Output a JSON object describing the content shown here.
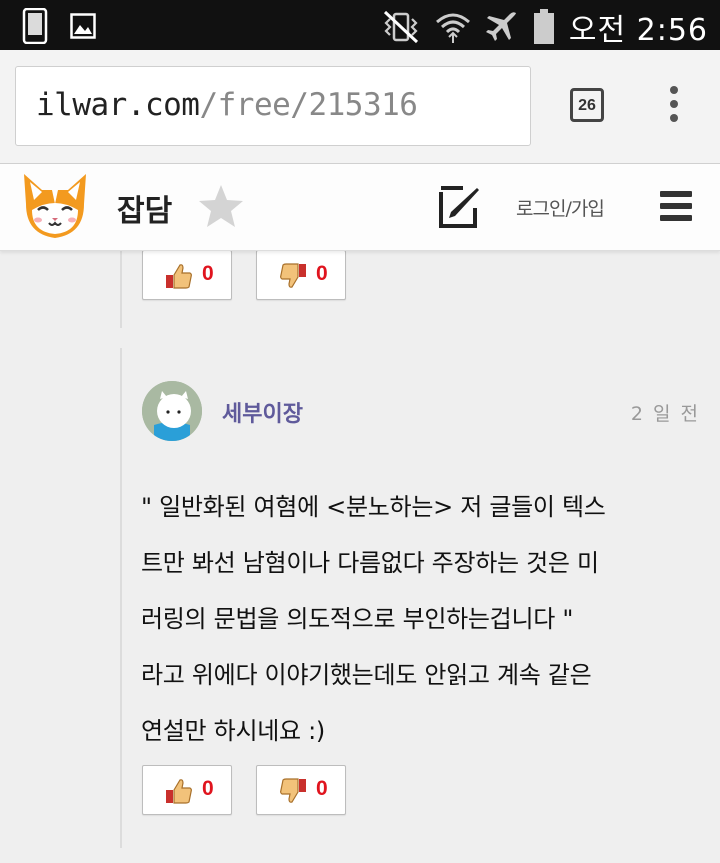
{
  "status_bar": {
    "time": "오전 2:56",
    "icons": [
      "phone-icon",
      "image-icon",
      "vibrate-icon",
      "wifi-icon",
      "airplane-icon",
      "battery-icon"
    ]
  },
  "browser": {
    "url_host": "ilwar.com",
    "url_path": "/free/215316",
    "tab_count": "26"
  },
  "site_header": {
    "title": "잡담",
    "login_label": "로그인/가입"
  },
  "colors": {
    "vote_count": "#e0141e",
    "author": "#5f5a9b",
    "background": "#efefef"
  },
  "prev_comment": {
    "likes": "0",
    "dislikes": "0"
  },
  "comment": {
    "author": "세부이장",
    "time_ago": "2 일 전",
    "lines": [
      "\" 일반화된 여혐에 <분노하는> 저 글들이 텍스",
      "트만 봐선 남혐이나 다름없다 주장하는 것은 미",
      "러링의 문법을 의도적으로 부인하는겁니다 \"",
      "라고 위에다 이야기했는데도 안읽고 계속 같은",
      "연설만 하시네요 :)"
    ],
    "likes": "0",
    "dislikes": "0"
  }
}
